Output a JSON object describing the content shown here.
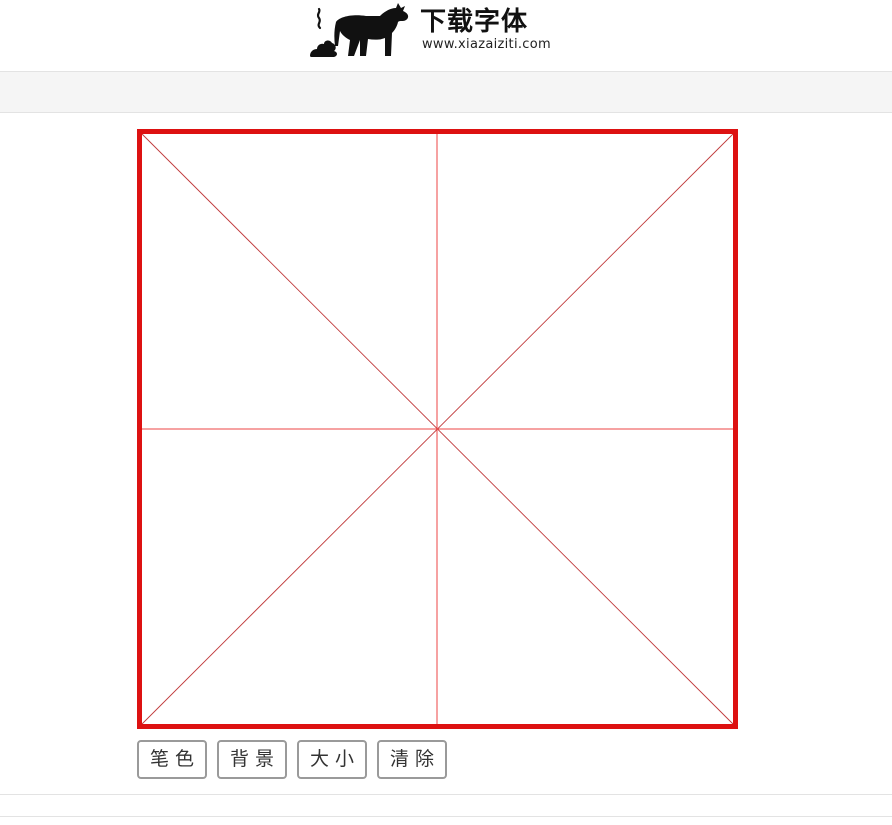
{
  "header": {
    "logo": {
      "icon": "cow-logo-icon",
      "title": "下载字体",
      "url": "www.xiazaiziti.com"
    }
  },
  "canvas": {
    "grid": "米字格",
    "border_color": "#dd1111",
    "guide_color": "#ee4444"
  },
  "toolbar": {
    "pen_color_label": "笔色",
    "background_label": "背景",
    "size_label": "大小",
    "clear_label": "清除"
  }
}
